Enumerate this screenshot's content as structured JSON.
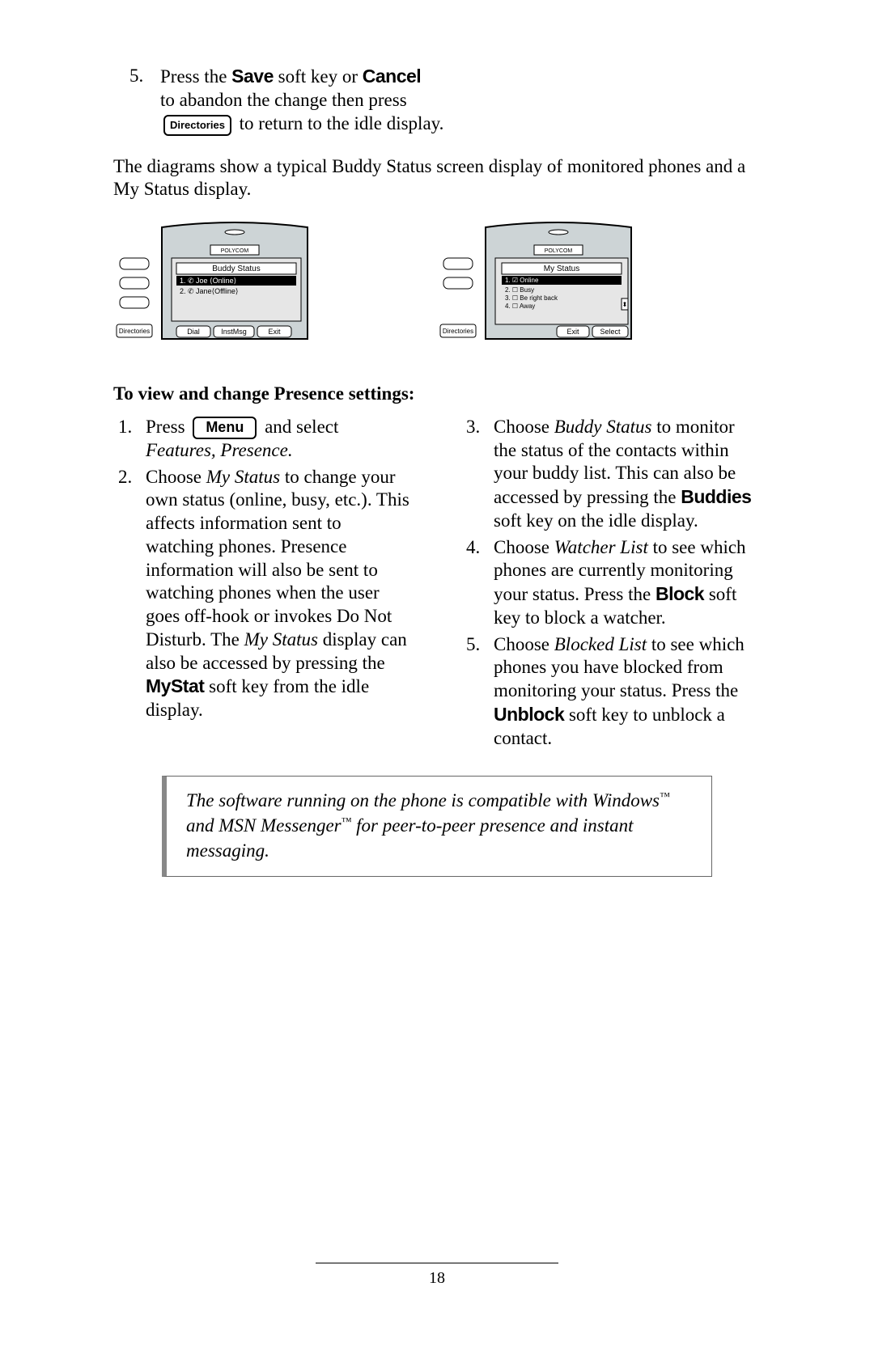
{
  "step5": {
    "marker": "5.",
    "t1": "Press the ",
    "save": "Save",
    "t2": " soft key or ",
    "cancel": "Cancel",
    "t3": "to abandon the change then press",
    "dirBtn": "Directories",
    "t4": " to return to the idle display."
  },
  "intro": "The diagrams show a typical Buddy Status screen display of monitored phones and a My Status display.",
  "phoneLeft": {
    "brand": "POLYCOM",
    "title": "Buddy Status",
    "row1": "1. ✆ Joe ⟨Online⟩",
    "row2": "2. ✆ Jane⟨Offline⟩",
    "side": "Directories",
    "sk1": "Dial",
    "sk2": "InstMsg",
    "sk3": "Exit"
  },
  "phoneRight": {
    "brand": "POLYCOM",
    "title": "My Status",
    "row1": "1. ☑ Online",
    "row2": "2. ☐ Busy",
    "row3": "3. ☐ Be right back",
    "row4": "4. ☐ Away",
    "side": "Directories",
    "sk1": "Exit",
    "sk2": "Select"
  },
  "heading": "To view and change Presence settings:",
  "left": {
    "s1": {
      "marker": "1.",
      "a": "Press ",
      "menu": "Menu",
      "b": " and select ",
      "fp": "Features, Presence."
    },
    "s2": {
      "marker": "2.",
      "a": "Choose ",
      "my": "My Status",
      "b": " to change your own status (online, busy, etc.). This affects information sent to watching phones. Presence information will also be sent to watching phones when the user goes off-hook or invokes Do Not Disturb. The ",
      "my2": "My Status",
      "c": " display can also be accessed by pressing the ",
      "mystat": "MyStat",
      "d": " soft key from the idle display."
    }
  },
  "right": {
    "s3": {
      "marker": "3.",
      "a": "Choose ",
      "bs": "Buddy Status",
      "b": " to monitor the status of the contacts within your buddy list.  This can also be accessed by pressing the ",
      "buddies": "Buddies",
      "c": " soft key on the idle display."
    },
    "s4": {
      "marker": "4.",
      "a": "Choose ",
      "wl": "Watcher List",
      "b": " to see which phones are currently monitoring your status.  Press the ",
      "block": "Block",
      "c": " soft key to block a watcher."
    },
    "s5": {
      "marker": "5.",
      "a": "Choose ",
      "bl": "Blocked List",
      "b": " to see which phones you have blocked from monitoring your status.  Press the ",
      "unblock": "Unblock",
      "c": " soft key to unblock a contact."
    }
  },
  "note": {
    "a": "The software running on the phone is compatible with Windows",
    "tm1": "™",
    "b": " and MSN Messenger",
    "tm2": "™",
    "c": " for peer-to-peer  presence and instant messaging."
  },
  "pageNumber": "18"
}
